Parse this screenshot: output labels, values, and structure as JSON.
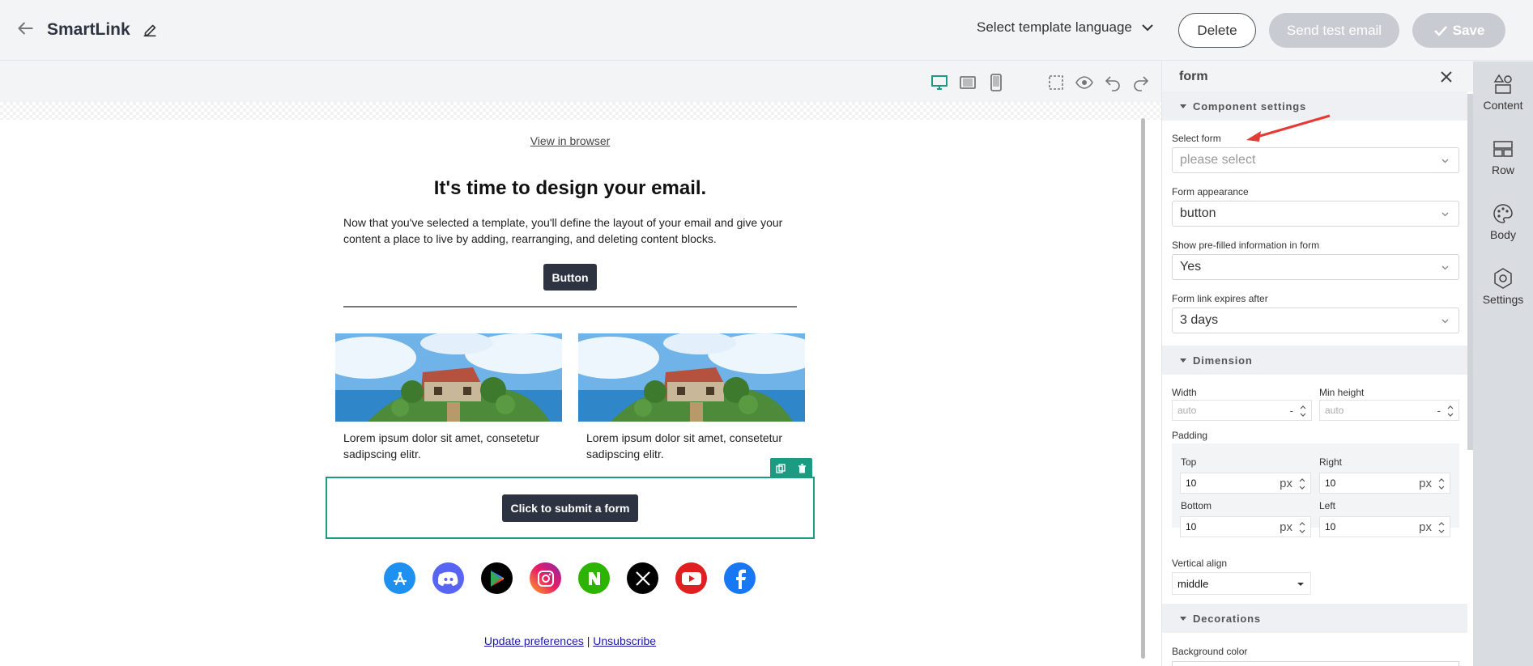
{
  "header": {
    "title": "SmartLink",
    "language_select": "Select template language",
    "delete_label": "Delete",
    "send_test_label": "Send test email",
    "save_label": "Save"
  },
  "email": {
    "view_in_browser": "View in browser",
    "heading": "It's time to design your email.",
    "body": "Now that you've selected a template, you'll define the layout of your email and give your content a place to live by adding, rearranging, and deleting content blocks.",
    "button_label": "Button",
    "image_captions": [
      "Lorem ipsum dolor sit amet, consetetur sadipscing elitr.",
      "Lorem ipsum dolor sit amet, consetetur sadipscing elitr."
    ],
    "form_button_label": "Click to submit a form",
    "social_icons": [
      "app-store-icon",
      "discord-icon",
      "google-play-icon",
      "instagram-icon",
      "naver-icon",
      "x-icon",
      "youtube-icon",
      "facebook-icon"
    ],
    "footer": {
      "update_preferences": "Update preferences",
      "separator": "|",
      "unsubscribe": "Unsubscribe"
    }
  },
  "panel": {
    "title": "form",
    "component_settings": {
      "heading": "Component settings",
      "select_form_label": "Select form",
      "select_form_placeholder": "please select",
      "form_appearance_label": "Form appearance",
      "form_appearance_value": "button",
      "prefilled_label": "Show pre-filled information in form",
      "prefilled_value": "Yes",
      "expires_label": "Form link expires after",
      "expires_value": "3 days"
    },
    "dimension": {
      "heading": "Dimension",
      "width_label": "Width",
      "width_value": "auto",
      "min_height_label": "Min height",
      "min_height_value": "auto",
      "dash": "-",
      "padding_label": "Padding",
      "top_label": "Top",
      "top_value": "10",
      "right_label": "Right",
      "right_value": "10",
      "bottom_label": "Bottom",
      "bottom_value": "10",
      "left_label": "Left",
      "left_value": "10",
      "unit": "px",
      "vertical_align_label": "Vertical align",
      "vertical_align_value": "middle"
    },
    "decorations": {
      "heading": "Decorations",
      "background_color_label": "Background color"
    }
  },
  "rail": {
    "content": "Content",
    "row": "Row",
    "body": "Body",
    "settings": "Settings"
  },
  "colors": {
    "accent": "#1a9b82",
    "dark_button": "#2d3340",
    "annotation_arrow": "#e53935"
  }
}
